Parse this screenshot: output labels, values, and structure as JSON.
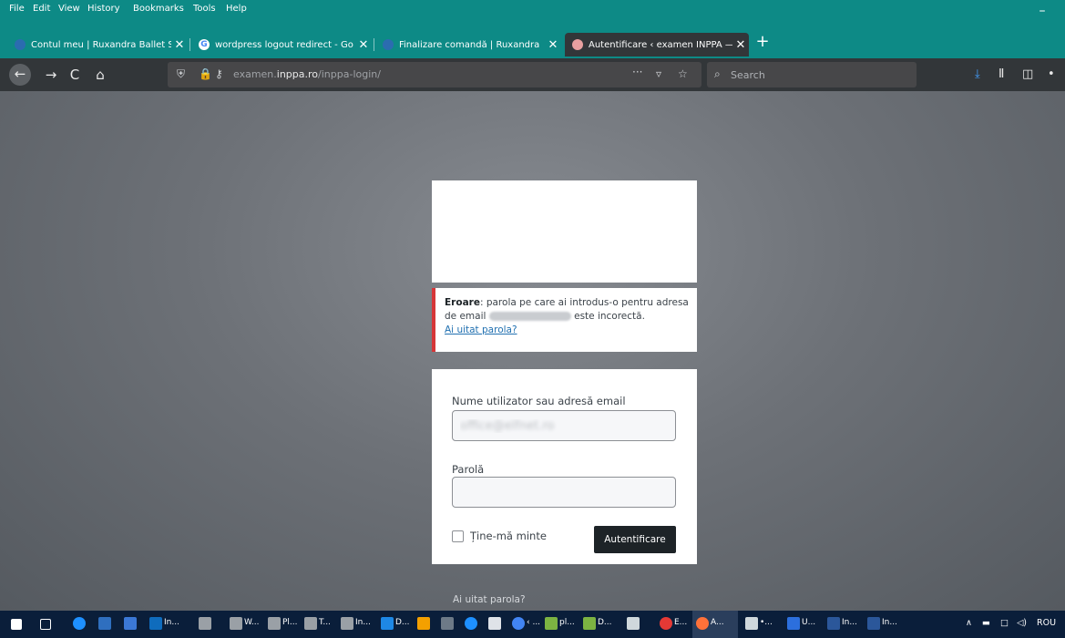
{
  "menubar": {
    "items": [
      "File",
      "Edit",
      "View",
      "History",
      "Bookmarks",
      "Tools",
      "Help"
    ],
    "minimize": "–"
  },
  "tabs": [
    {
      "label": "Contul meu | Ruxandra Ballet S",
      "close": "✕",
      "favicon_color": "#2b6cb0"
    },
    {
      "label": "wordpress logout redirect - Go",
      "close": "✕",
      "favicon_color": "#ffffff"
    },
    {
      "label": "Finalizare comandă | Ruxandra",
      "close": "✕",
      "favicon_color": "#2b6cb0"
    },
    {
      "label": "Autentificare ‹ examen INPPA —",
      "close": "✕",
      "favicon_color": "#e8a0a0"
    }
  ],
  "new_tab": "+",
  "navbar": {
    "back": "←",
    "forward": "→",
    "reload": "C",
    "home": "⌂",
    "url_prefix": "examen.",
    "url_host": "inppa.ro",
    "url_path": "/inppa-login/",
    "page_actions": "···",
    "search_placeholder": "Search"
  },
  "login": {
    "error_strong": "Eroare",
    "error_text_1": ": parola pe care ai introdus-o pentru adresa de email",
    "error_text_2": "este incorectă.",
    "error_link": "Ai uitat parola?",
    "username_label": "Nume utilizator sau adresă email",
    "username_value": "office@elfnet.ro",
    "password_label": "Parolă",
    "password_value": "",
    "remember_label": "Ține-mă minte",
    "submit_label": "Autentificare",
    "bottom_link": "Ai uitat parola?"
  },
  "taskbar": {
    "labels": [
      "In...",
      "W...",
      "Pl...",
      "T...",
      "In...",
      "D...",
      "‹ ...",
      "pl...",
      "D...",
      "E...",
      "A...",
      "•...",
      "U...",
      "In...",
      "In..."
    ],
    "language": "ROU"
  }
}
